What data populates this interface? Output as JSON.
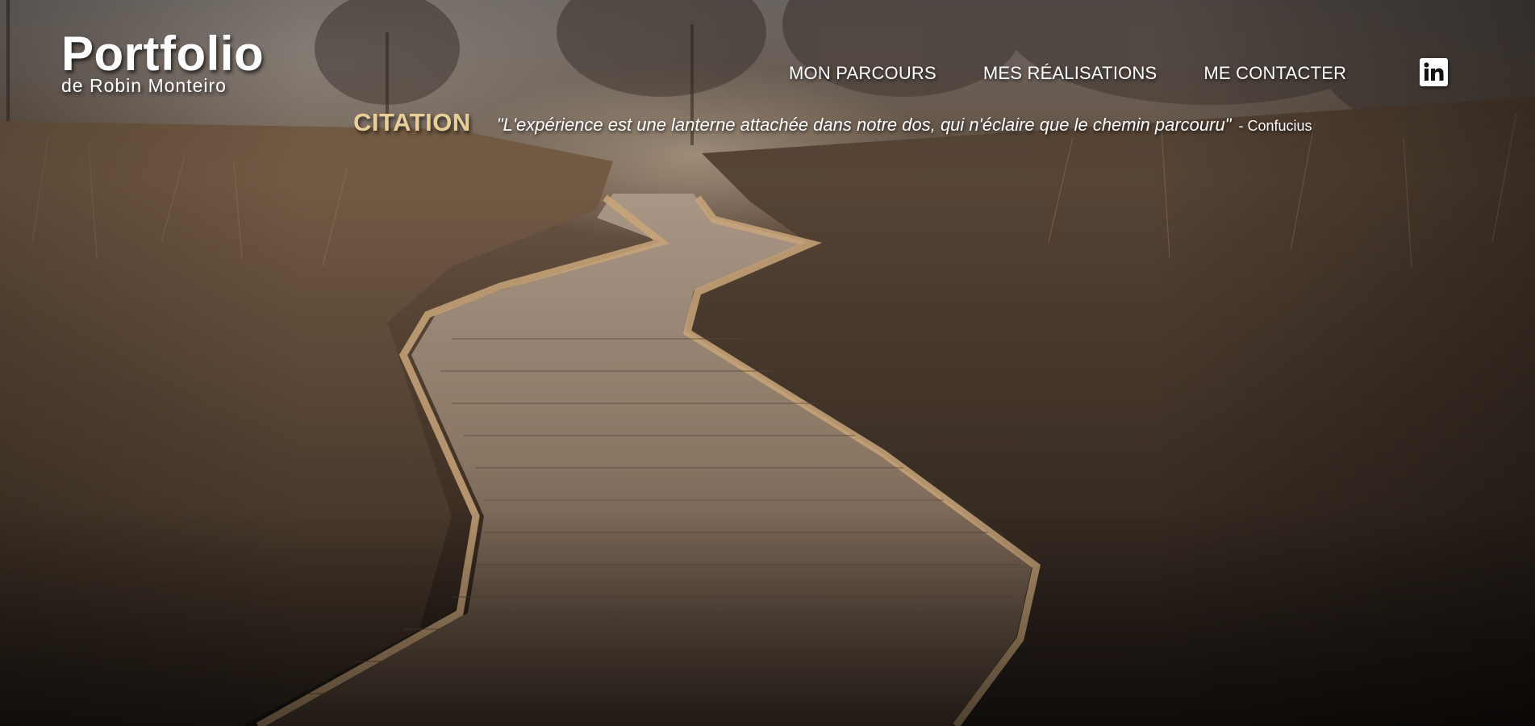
{
  "brand": {
    "title": "Portfolio",
    "subtitle": "de Robin Monteiro"
  },
  "nav": {
    "items": [
      {
        "label": "MON PARCOURS"
      },
      {
        "label": "MES RÉALISATIONS"
      },
      {
        "label": "ME CONTACTER"
      }
    ]
  },
  "social": {
    "linkedin_icon": "linkedin-icon"
  },
  "quote": {
    "label": "CITATION",
    "text": "\"L'expérience est une lanterne attachée dans notre dos, qui n'éclaire que le chemin parcouru\"",
    "author": "- Confucius"
  },
  "colors": {
    "quote_label": "#e9cf97",
    "text": "#ffffff"
  }
}
